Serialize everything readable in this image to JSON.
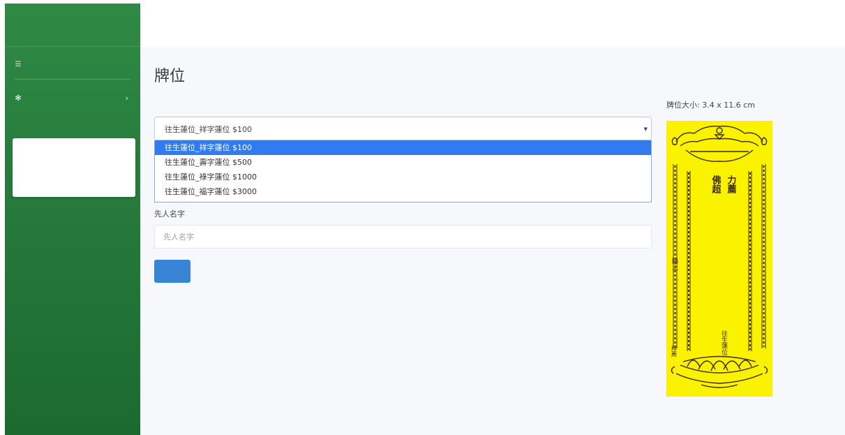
{
  "sidebar": {
    "brand": "",
    "section_label": "",
    "home_link": "",
    "group_label": "",
    "sub_items": [
      {
        "label": ""
      },
      {
        "label": ""
      }
    ]
  },
  "main": {
    "title": "牌位",
    "type_label": "",
    "select": {
      "selected": "往生蓮位_祥字蓮位 $100",
      "options": [
        "往生蓮位_祥字蓮位 $100",
        "往生蓮位_壽字蓮位 $500",
        "往生蓮位_祿字蓮位 $1000",
        "往生蓮位_福字蓮位 $3000"
      ]
    },
    "name_label": "先人名字",
    "name_placeholder": "先人名字",
    "submit_label": ""
  },
  "tablet": {
    "size_text": "牌位大小: 3.4 x 11.6 cm",
    "inscription_right": "力薦",
    "inscription_left": "佛超",
    "bottom_center": "往生蓮位",
    "side_left": "陽上",
    "bottom_left": "拜薦"
  },
  "colors": {
    "sidebar": "#267a3b",
    "accent": "#2f7bf0",
    "button": "#3a84d6",
    "tablet_bg": "#fbf200"
  }
}
